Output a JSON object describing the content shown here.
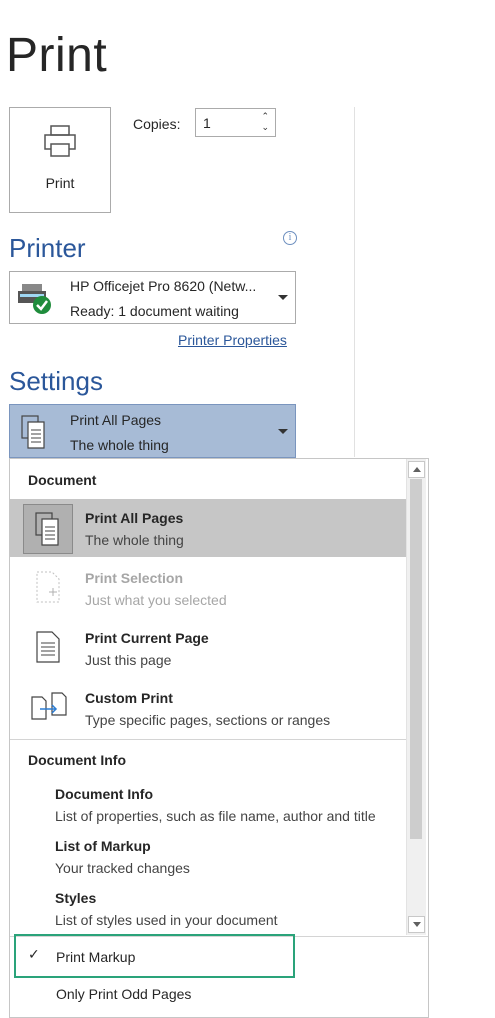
{
  "header": {
    "title": "Print"
  },
  "print_button": {
    "label": "Print"
  },
  "copies": {
    "label": "Copies:",
    "value": "1"
  },
  "printer": {
    "heading": "Printer",
    "info_icon": "info-icon",
    "name": "HP Officejet Pro 8620 (Netw...",
    "status": "Ready: 1 document waiting",
    "properties_link": "Printer Properties"
  },
  "settings": {
    "heading": "Settings",
    "selected_title": "Print All Pages",
    "selected_subtitle": "The whole thing"
  },
  "dropdown": {
    "group_document": "Document",
    "items": [
      {
        "title": "Print All Pages",
        "subtitle": "The whole thing"
      },
      {
        "title": "Print Selection",
        "subtitle": "Just what you selected"
      },
      {
        "title": "Print Current Page",
        "subtitle": "Just this page"
      },
      {
        "title": "Custom Print",
        "subtitle": "Type specific pages, sections or ranges"
      }
    ],
    "group_info": "Document Info",
    "info_items": [
      {
        "title": "Document Info",
        "subtitle": "List of properties, such as file name, author and title"
      },
      {
        "title": "List of Markup",
        "subtitle": "Your tracked changes"
      },
      {
        "title": "Styles",
        "subtitle": "List of styles used in your document"
      }
    ],
    "print_markup": {
      "check": "✓",
      "label": "Print Markup"
    },
    "odd_pages": "Only Print Odd Pages"
  },
  "colors": {
    "accent": "#2b579a",
    "selected_bg": "#a7bbd6",
    "highlight": "#2aa37a"
  }
}
